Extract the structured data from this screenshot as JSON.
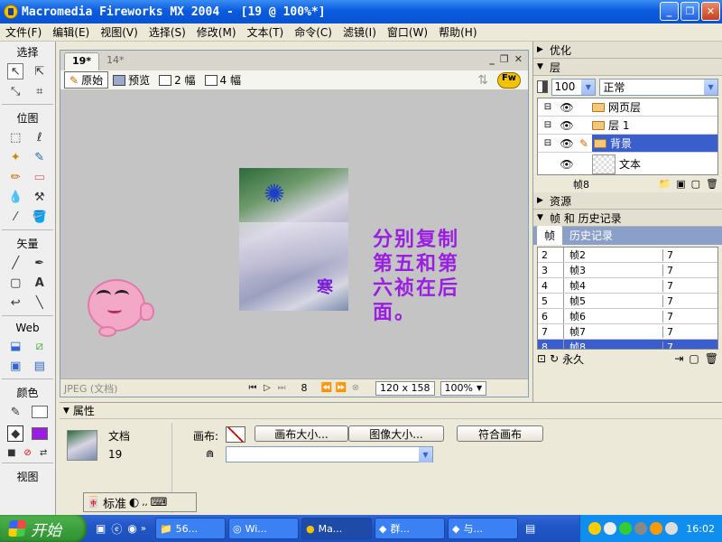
{
  "window": {
    "title": "Macromedia Fireworks MX 2004 - [19 @ 100%*]"
  },
  "menubar": [
    "文件(F)",
    "编辑(E)",
    "视图(V)",
    "选择(S)",
    "修改(M)",
    "文本(T)",
    "命令(C)",
    "滤镜(I)",
    "窗口(W)",
    "帮助(H)"
  ],
  "tools": {
    "sections": [
      "选择",
      "位图",
      "矢量",
      "Web",
      "颜色",
      "视图"
    ]
  },
  "document": {
    "tabs": [
      "19*",
      "14*"
    ],
    "views": [
      "原始",
      "预览",
      "2 幅",
      "4 幅"
    ],
    "canvas_text": "分别复制第五和第六祯在后面。",
    "image_caption": "寒",
    "status": {
      "format": "JPEG (文档)",
      "frame": "8",
      "size": "120 x 158",
      "zoom": "100%"
    }
  },
  "panels": {
    "optimize": "优化",
    "layers": {
      "title": "层",
      "opacity": "100",
      "blend": "正常",
      "items": [
        {
          "name": "网页层",
          "selected": false
        },
        {
          "name": "层 1",
          "selected": false
        },
        {
          "name": "背景",
          "selected": true
        },
        {
          "name": "文本",
          "selected": false
        }
      ],
      "footer_frame": "帧8"
    },
    "assets": "资源",
    "frames_history": {
      "title": "帧 和 历史记录",
      "tabs": [
        "帧",
        "历史记录"
      ],
      "rows": [
        {
          "num": "2",
          "name": "帧2",
          "delay": "7",
          "selected": false
        },
        {
          "num": "3",
          "name": "帧3",
          "delay": "7",
          "selected": false
        },
        {
          "num": "4",
          "name": "帧4",
          "delay": "7",
          "selected": false
        },
        {
          "num": "5",
          "name": "帧5",
          "delay": "7",
          "selected": false
        },
        {
          "num": "6",
          "name": "帧6",
          "delay": "7",
          "selected": false
        },
        {
          "num": "7",
          "name": "帧7",
          "delay": "7",
          "selected": false
        },
        {
          "num": "8",
          "name": "帧8",
          "delay": "7",
          "selected": true
        }
      ],
      "loop": "永久"
    }
  },
  "properties": {
    "title": "属性",
    "doc_label": "文档",
    "doc_name": "19",
    "canvas_label": "画布:",
    "buttons": [
      "画布大小...",
      "图像大小...",
      "符合画布"
    ]
  },
  "ime": {
    "mode": "标准"
  },
  "taskbar": {
    "start": "开始",
    "tasks": [
      "56...",
      "Wi...",
      "Ma...",
      "群...",
      "与..."
    ],
    "clock": "16:02"
  },
  "colors": {
    "canvas_text": "#9a1fe0",
    "selection": "#3a5fcd",
    "taskbar": "#2157c6"
  }
}
